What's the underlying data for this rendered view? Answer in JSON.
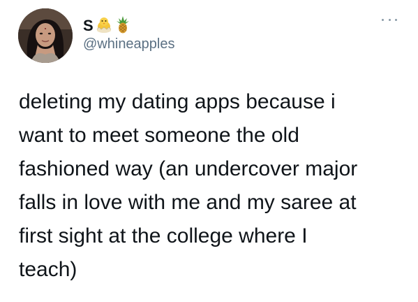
{
  "author": {
    "display_name": "S",
    "name_emojis": [
      "baby-chick-emoji",
      "pineapple-emoji"
    ],
    "handle": "@whineapples"
  },
  "tweet": {
    "text": "deleting my dating apps because i\nwant to meet someone the old\nfashioned way (an undercover major\nfalls in love with me and my saree at\nfirst sight at the college where I\nteach)"
  },
  "icons": {
    "more": "more-horizontal-icon"
  },
  "colors": {
    "text": "#0f1419",
    "secondary": "#5b7083",
    "icon": "#8899a6",
    "background": "#ffffff"
  }
}
